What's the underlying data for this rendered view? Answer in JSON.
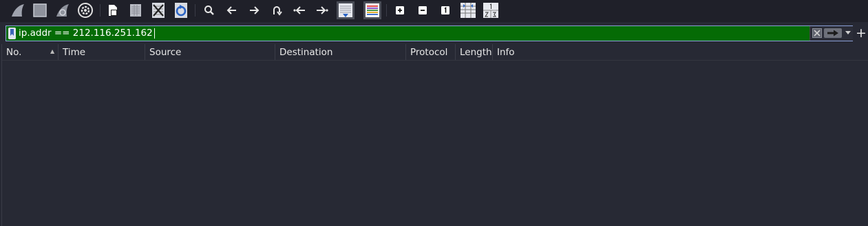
{
  "toolbar": {
    "buttons": [
      {
        "name": "start-capture-icon"
      },
      {
        "name": "stop-capture-icon"
      },
      {
        "name": "restart-capture-icon"
      },
      {
        "name": "capture-options-icon"
      },
      {
        "name": "open-file-icon"
      },
      {
        "name": "save-file-icon"
      },
      {
        "name": "close-file-icon"
      },
      {
        "name": "reload-file-icon"
      },
      {
        "name": "find-packet-icon"
      },
      {
        "name": "go-back-icon"
      },
      {
        "name": "go-forward-icon"
      },
      {
        "name": "go-to-packet-icon"
      },
      {
        "name": "first-packet-icon"
      },
      {
        "name": "last-packet-icon"
      },
      {
        "name": "auto-scroll-icon"
      },
      {
        "name": "colorize-icon"
      },
      {
        "name": "zoom-in-icon"
      },
      {
        "name": "zoom-out-icon"
      },
      {
        "name": "normal-size-icon"
      },
      {
        "name": "resize-columns-icon"
      },
      {
        "name": "layout-icon"
      }
    ]
  },
  "filter": {
    "value": "ip.addr == 212.116.251.162",
    "background_color": "#056b05",
    "add_label": "+"
  },
  "packet_list": {
    "columns": [
      "No.",
      "Time",
      "Source",
      "Destination",
      "Protocol",
      "Length",
      "Info"
    ],
    "sort_indicator": "▲",
    "rows": []
  }
}
